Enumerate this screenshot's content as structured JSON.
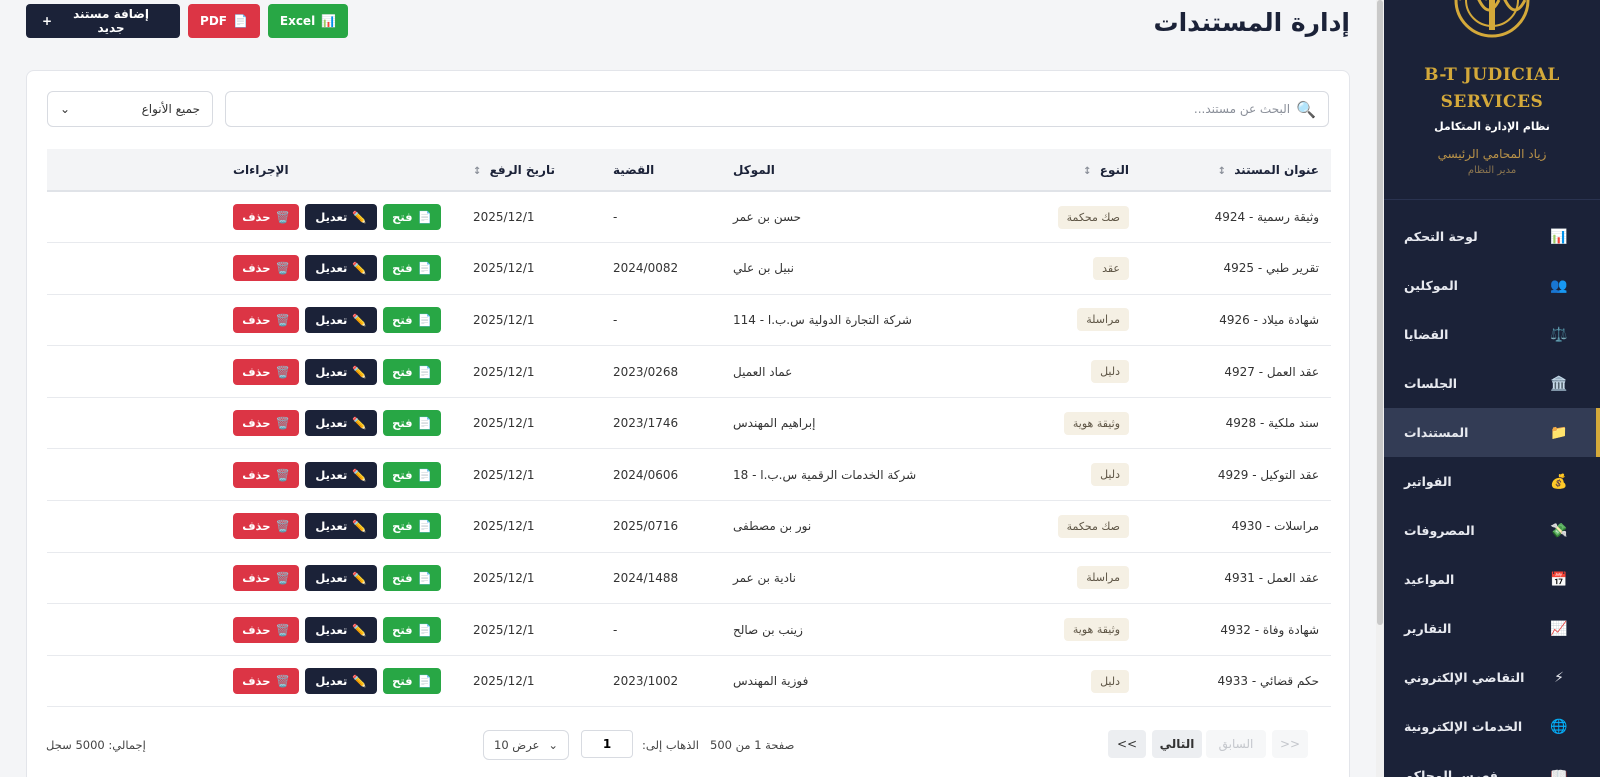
{
  "sidebar": {
    "brand_line1": "B-T JUDICIAL",
    "brand_line2": "SERVICES",
    "brand_sub": "نظام الإدارة المتكامل",
    "user_name": "زياد المحامي الرئيسي",
    "user_role": "مدير النظام",
    "accent_color": "#d4a93a",
    "items": [
      {
        "label": "لوحة التحكم",
        "icon": "📊",
        "icon_name": "bar-chart-icon"
      },
      {
        "label": "الموكلين",
        "icon": "👥",
        "icon_name": "users-icon"
      },
      {
        "label": "القضايا",
        "icon": "⚖️",
        "icon_name": "scales-icon"
      },
      {
        "label": "الجلسات",
        "icon": "🏛️",
        "icon_name": "courthouse-icon"
      },
      {
        "label": "المستندات",
        "icon": "📁",
        "icon_name": "folder-icon",
        "active": true
      },
      {
        "label": "الفواتير",
        "icon": "💰",
        "icon_name": "money-bag-icon"
      },
      {
        "label": "المصروفات",
        "icon": "💸",
        "icon_name": "money-wings-icon"
      },
      {
        "label": "المواعيد",
        "icon": "📅",
        "icon_name": "calendar-icon"
      },
      {
        "label": "التقارير",
        "icon": "📈",
        "icon_name": "trend-chart-icon"
      },
      {
        "label": "التقاضي الإلكتروني",
        "icon": "⚡",
        "icon_name": "lightning-icon"
      },
      {
        "label": "الخدمات الإلكترونية",
        "icon": "🌐",
        "icon_name": "globe-icon"
      },
      {
        "label": "فهرس المحاكم",
        "icon": "📖",
        "icon_name": "book-icon"
      }
    ]
  },
  "header": {
    "title": "إدارة المستندات",
    "add_button": "إضافة مستند جديد",
    "add_icon": "+",
    "pdf_button": "PDF",
    "pdf_icon": "📄",
    "excel_button": "Excel",
    "excel_icon": "📊"
  },
  "filters": {
    "search_placeholder": "البحث عن مستند...",
    "search_icon": "🔍",
    "type_select": "جميع الأنواع",
    "type_arrow": "⌄"
  },
  "table": {
    "sort_glyph": "↕",
    "columns": {
      "title": "عنوان المستند",
      "type": "النوع",
      "client": "الموكل",
      "case": "القضية",
      "date": "تاريخ الرفع",
      "actions": "الإجراءات"
    },
    "actions": {
      "open": "فتح",
      "open_icon": "📄",
      "edit": "تعديل",
      "edit_icon": "✏️",
      "delete": "حذف",
      "delete_icon": "🗑️"
    },
    "rows": [
      {
        "title": "وثيقة رسمية - 4924",
        "type": "صك محكمة",
        "client": "حسن بن عمر",
        "case": "-",
        "date": "2025/12/1"
      },
      {
        "title": "تقرير طبي - 4925",
        "type": "عقد",
        "client": "نبيل بن علي",
        "case": "2024/0082",
        "date": "2025/12/1"
      },
      {
        "title": "شهادة ميلاد - 4926",
        "type": "مراسلة",
        "client": "شركة التجارة الدولية س.ب.ا - 114",
        "case": "-",
        "date": "2025/12/1"
      },
      {
        "title": "عقد العمل - 4927",
        "type": "دليل",
        "client": "عماد العميل",
        "case": "2023/0268",
        "date": "2025/12/1"
      },
      {
        "title": "سند ملكية - 4928",
        "type": "وثيقة هوية",
        "client": "إبراهيم المهندس",
        "case": "2023/1746",
        "date": "2025/12/1"
      },
      {
        "title": "عقد التوكيل - 4929",
        "type": "دليل",
        "client": "شركة الخدمات الرقمية س.ب.ا - 18",
        "case": "2024/0606",
        "date": "2025/12/1"
      },
      {
        "title": "مراسلات - 4930",
        "type": "صك محكمة",
        "client": "نور بن مصطفى",
        "case": "2025/0716",
        "date": "2025/12/1"
      },
      {
        "title": "عقد العمل - 4931",
        "type": "مراسلة",
        "client": "نادية بن عمر",
        "case": "2024/1488",
        "date": "2025/12/1"
      },
      {
        "title": "شهادة وفاة - 4932",
        "type": "وثيقة هوية",
        "client": "زينب بن صالح",
        "case": "-",
        "date": "2025/12/1"
      },
      {
        "title": "حكم قضائي - 4933",
        "type": "دليل",
        "client": "فوزية المهندس",
        "case": "2023/1002",
        "date": "2025/12/1"
      }
    ]
  },
  "pagination": {
    "total": "إجمالي: 5000 سجل",
    "per_page": "عرض 10",
    "per_page_arrow": "⌄",
    "goto_label": "الذهاب إلى:",
    "goto_value": "1",
    "page_info": "صفحة 1 من 500",
    "last": ">>",
    "next": "التالي",
    "prev": "السابق",
    "first": "<<"
  },
  "colors": {
    "navy": "#1b2238",
    "green": "#28a745",
    "red": "#dc3545",
    "gold": "#d4a93a"
  }
}
